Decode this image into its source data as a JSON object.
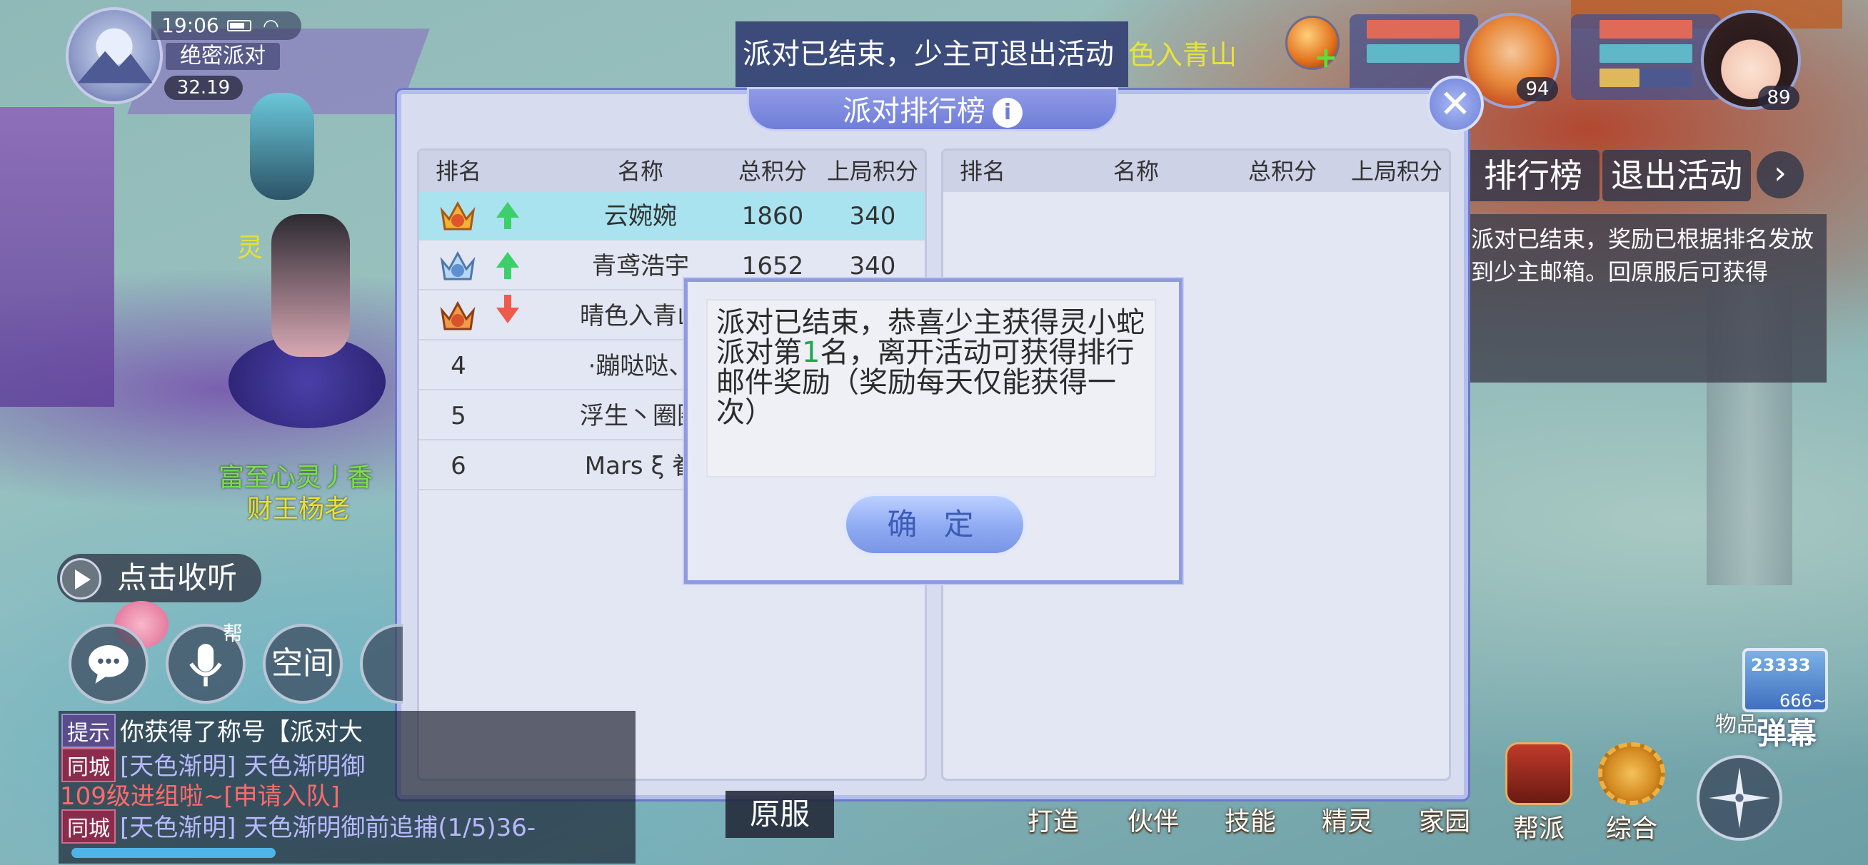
{
  "status": {
    "time": "19:06",
    "activity_name": "绝密派对",
    "score": "32.19"
  },
  "banner": {
    "notice": "派对已结束，少主可退出活动",
    "notice_tail": "色入青山"
  },
  "team": [
    {
      "level": "94"
    },
    {
      "level": "89"
    }
  ],
  "side": {
    "ranking_tab": "排行榜",
    "exit_tab": "退出活动",
    "message": "派对已结束，奖励已根据排名发放到少主邮箱。回原服后可获得"
  },
  "window": {
    "title": "派对排行榜",
    "close_label": "✕",
    "headers": [
      "排名",
      "名称",
      "总积分",
      "上局积分"
    ],
    "rows": [
      {
        "rank": "1",
        "medal": "gold",
        "trend": "up",
        "name": "云婉婉",
        "total": "1860",
        "last": "340"
      },
      {
        "rank": "2",
        "medal": "silver",
        "trend": "up",
        "name": "青鸢浩宇",
        "total": "1652",
        "last": "340"
      },
      {
        "rank": "3",
        "medal": "bronze",
        "trend": "down",
        "name": "晴色入青山",
        "total": "",
        "last": ""
      },
      {
        "rank": "4",
        "medal": "",
        "trend": "",
        "name": "·蹦哒哒、",
        "total": "",
        "last": ""
      },
      {
        "rank": "5",
        "medal": "",
        "trend": "",
        "name": "浮生丶圈圈",
        "total": "",
        "last": ""
      },
      {
        "rank": "6",
        "medal": "",
        "trend": "",
        "name": "Mars ξ 眷",
        "total": "",
        "last": ""
      }
    ]
  },
  "dialog": {
    "message_prefix": "派对已结束，恭喜少主获得灵小蛇派对第",
    "rank_number": "1",
    "message_suffix": "名，离开活动可获得排行邮件奖励（奖励每天仅能获得一次）",
    "ok_label": "确 定"
  },
  "listen": {
    "label": "点击收听"
  },
  "bottom_left": {
    "help_badge": "帮",
    "space_label": "空间"
  },
  "chat": [
    {
      "tag": "提示",
      "tag_type": "tip",
      "text": "你获得了称号【派对大",
      "color": "#ffffff"
    },
    {
      "tag": "同城",
      "tag_type": "city",
      "text": "[天色渐明] 天色渐明御",
      "color": "#d6d6ff",
      "name_color": "#4fe04a"
    },
    {
      "tag": "",
      "tag_type": "",
      "text": "109级进组啦~[申请入队]",
      "color": "#ff6b6b"
    },
    {
      "tag": "同城",
      "tag_type": "city",
      "text": "[天色渐明] 天色渐明御前追捕(1/5)36-",
      "color": "#d6d6ff"
    }
  ],
  "origin_button": "原服",
  "menu": [
    "打造",
    "伙伴",
    "技能",
    "精灵",
    "家园",
    "帮派",
    "综合"
  ],
  "danmu": {
    "count": "23333",
    "sub": "666~",
    "label": "弹幕",
    "bag": "物品"
  },
  "world_labels": {
    "player_left": "富至心灵丿香",
    "player_left2": "财王杨老",
    "left_char": "灵"
  },
  "colors": {
    "accent": "#6f7dd8",
    "highlight_row": "#a9e3ef",
    "trend_up": "#3dcf6a",
    "trend_down": "#f05a4c",
    "rank_highlight": "#1ea84a"
  }
}
